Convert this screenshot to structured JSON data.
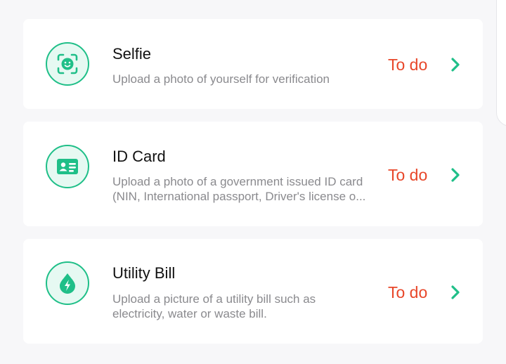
{
  "colors": {
    "accent_green": "#1fbf88",
    "icon_bg": "#e6f9f2",
    "status_red": "#e8472a",
    "page_bg": "#f7f7f9",
    "card_bg": "#ffffff"
  },
  "items": [
    {
      "title": "Selfie",
      "description": [
        "Upload a photo of yourself for verification"
      ],
      "status": "To do",
      "icon": "face-scan-icon"
    },
    {
      "title": "ID Card",
      "description": [
        "Upload a photo of a government issued ID card",
        "(NIN, International passport, Driver's license o..."
      ],
      "status": "To do",
      "icon": "id-card-icon"
    },
    {
      "title": "Utility Bill",
      "description": [
        "Upload a picture of a utility bill such as",
        "electricity, water or waste bill."
      ],
      "status": "To do",
      "icon": "utility-drop-bolt-icon"
    }
  ]
}
